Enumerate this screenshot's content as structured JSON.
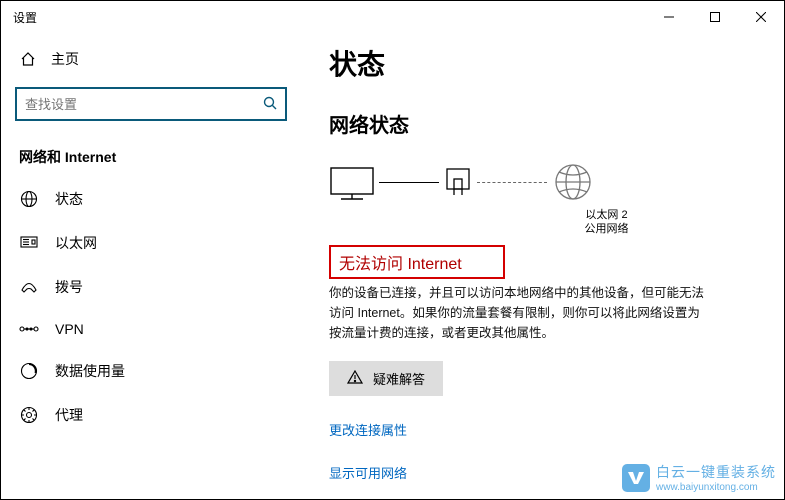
{
  "window": {
    "title": "设置"
  },
  "sidebar": {
    "home": "主页",
    "search_placeholder": "查找设置",
    "section": "网络和 Internet",
    "items": [
      {
        "label": "状态"
      },
      {
        "label": "以太网"
      },
      {
        "label": "拨号"
      },
      {
        "label": "VPN"
      },
      {
        "label": "数据使用量"
      },
      {
        "label": "代理"
      }
    ]
  },
  "content": {
    "h1": "状态",
    "h2": "网络状态",
    "adapter_name": "以太网 2",
    "adapter_type": "公用网络",
    "error_title": "无法访问 Internet",
    "desc": "你的设备已连接，并且可以访问本地网络中的其他设备，但可能无法访问 Internet。如果你的流量套餐有限制，则你可以将此网络设置为按流量计费的连接，或者更改其他属性。",
    "troubleshoot": "疑难解答",
    "link1": "更改连接属性",
    "link2": "显示可用网络"
  },
  "watermark": {
    "text": "白云一键重装系统",
    "url": "www.baiyunxitong.com"
  }
}
